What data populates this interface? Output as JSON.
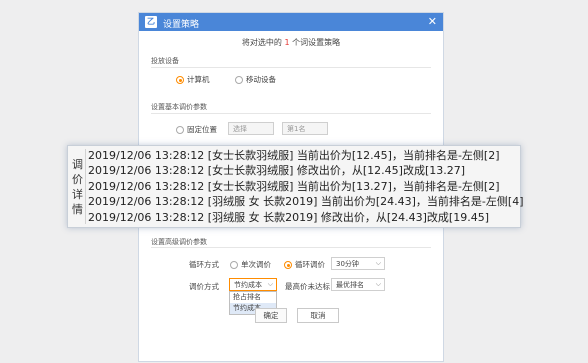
{
  "dialog": {
    "icon_text": "乙",
    "title": "设置策略",
    "close_symbol": "✕",
    "subtitle_prefix": "将对选中的",
    "subtitle_count": "1",
    "subtitle_suffix": "个词设置策略",
    "delivery": {
      "label": "投放设备",
      "options": [
        "计算机",
        "移动设备"
      ],
      "selected": "计算机"
    },
    "basic": {
      "label": "设置基本调价参数",
      "fixed_position_label": "固定位置",
      "input1_placeholder": "选择",
      "input2_placeholder": "第1名"
    },
    "advanced": {
      "label": "设置高级调价参数",
      "loop_label": "循环方式",
      "loop_options": [
        "单次调价",
        "循环调价"
      ],
      "loop_selected": "循环调价",
      "interval_value": "30分钟",
      "adjust_label": "调价方式",
      "adjust_value": "节约成本",
      "adjust_options": [
        "抢占排名",
        "节约成本"
      ],
      "adjust_selected": "节约成本",
      "max_price_label": "最高价未达标",
      "max_price_value": "最优排名"
    },
    "buttons": {
      "ok": "确定",
      "cancel": "取消"
    }
  },
  "details_panel": {
    "label": "调价详情",
    "lines": [
      "2019/12/06 13:28:12 [女士长款羽绒服] 当前出价为[12.45]，当前排名是-左侧[2]",
      "2019/12/06 13:28:12 [女士长款羽绒服] 修改出价，从[12.45]改成[13.27]",
      "2019/12/06 13:28:12 [女士长款羽绒服] 当前出价为[13.27]，当前排名是-左侧[2]",
      "2019/12/06 13:28:12 [羽绒服 女 长款2019] 当前出价为[24.43]，当前排名是-左侧[4]",
      "2019/12/06 13:28:12 [羽绒服 女 长款2019] 修改出价，从[24.43]改成[19.45]"
    ]
  },
  "colors": {
    "titlebar": "#4a86d8",
    "accent": "#ff8c00",
    "count": "#e53935"
  }
}
